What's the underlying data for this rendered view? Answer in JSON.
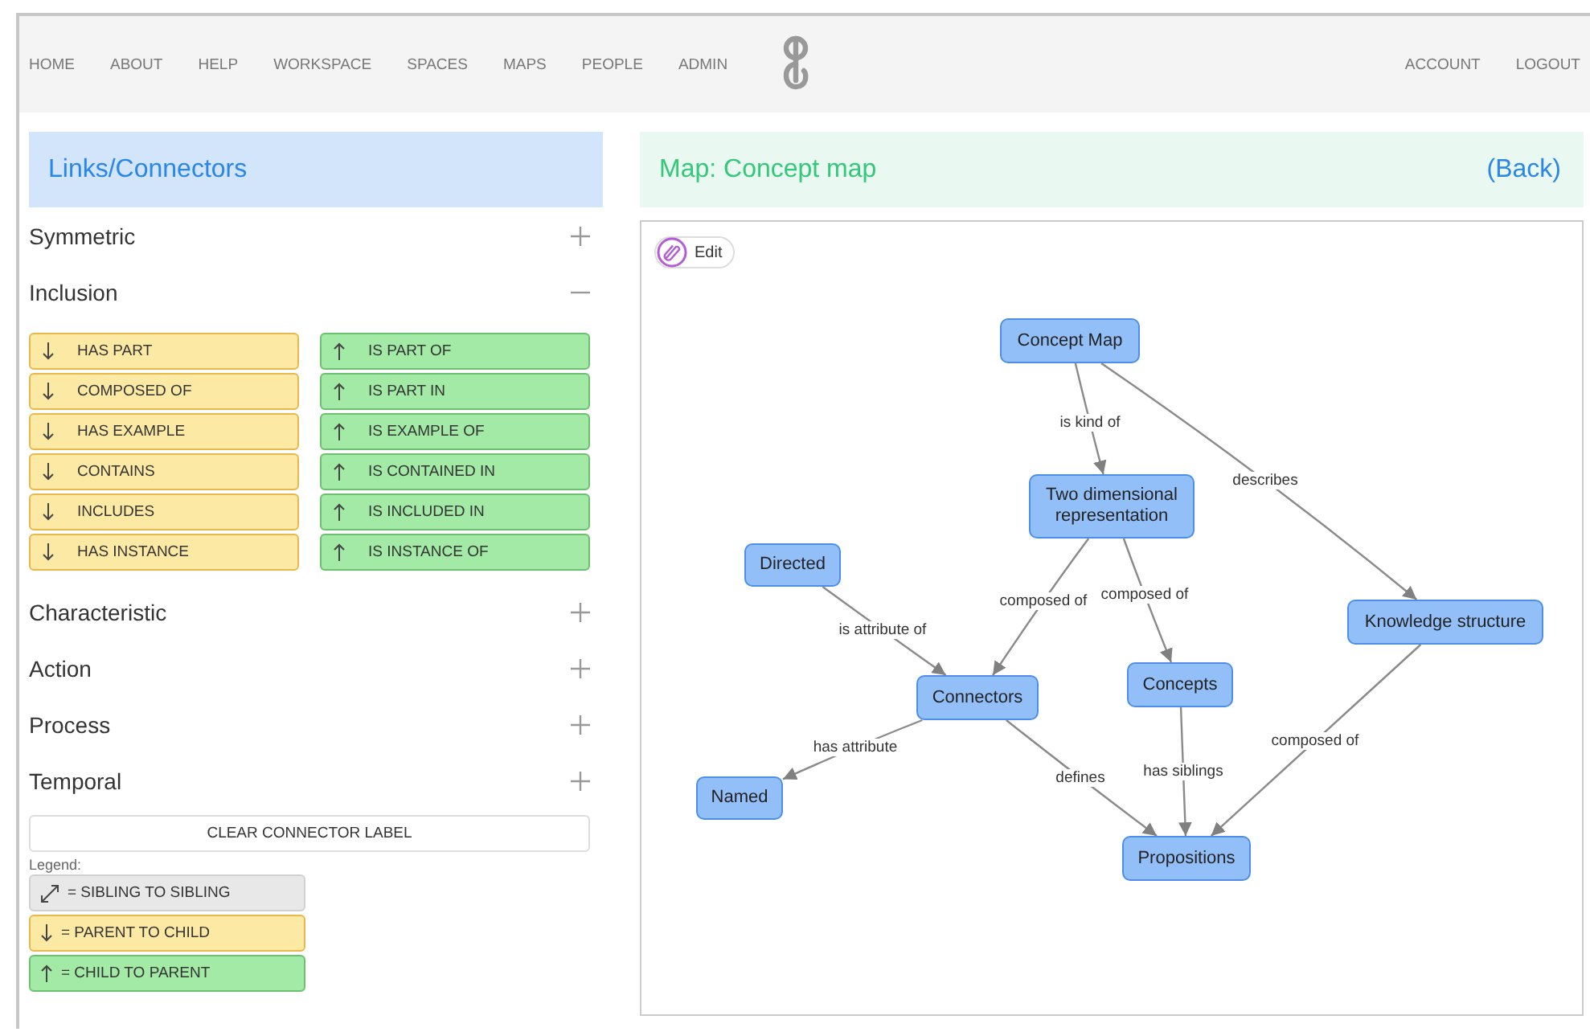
{
  "nav": {
    "left": [
      "HOME",
      "ABOUT",
      "HELP",
      "WORKSPACE",
      "SPACES",
      "MAPS",
      "PEOPLE",
      "ADMIN"
    ],
    "right": [
      "ACCOUNT",
      "LOGOUT"
    ]
  },
  "panel": {
    "title": "Links/Connectors",
    "categories": [
      {
        "name": "Symmetric",
        "expanded": false
      },
      {
        "name": "Inclusion",
        "expanded": true,
        "connectors": [
          {
            "label": "HAS PART",
            "kind": "parent"
          },
          {
            "label": "IS PART OF",
            "kind": "child"
          },
          {
            "label": "COMPOSED OF",
            "kind": "parent"
          },
          {
            "label": "IS PART IN",
            "kind": "child"
          },
          {
            "label": "HAS EXAMPLE",
            "kind": "parent"
          },
          {
            "label": "IS EXAMPLE OF",
            "kind": "child"
          },
          {
            "label": "CONTAINS",
            "kind": "parent"
          },
          {
            "label": "IS CONTAINED IN",
            "kind": "child"
          },
          {
            "label": "INCLUDES",
            "kind": "parent"
          },
          {
            "label": "IS INCLUDED IN",
            "kind": "child"
          },
          {
            "label": "HAS INSTANCE",
            "kind": "parent"
          },
          {
            "label": "IS INSTANCE OF",
            "kind": "child"
          }
        ]
      },
      {
        "name": "Characteristic",
        "expanded": false
      },
      {
        "name": "Action",
        "expanded": false
      },
      {
        "name": "Process",
        "expanded": false
      },
      {
        "name": "Temporal",
        "expanded": false
      }
    ],
    "clear_button": "CLEAR CONNECTOR LABEL",
    "legend": {
      "title": "Legend:",
      "items": [
        {
          "label": "= SIBLING TO SIBLING",
          "kind": "sibling"
        },
        {
          "label": "= PARENT TO CHILD",
          "kind": "parent"
        },
        {
          "label": "= CHILD TO PARENT",
          "kind": "child"
        }
      ]
    }
  },
  "map": {
    "title": "Map: Concept map",
    "back": "(Back)",
    "edit": "Edit",
    "nodes": [
      "Concept Map",
      "Two dimensional representation",
      "Directed",
      "Knowledge structure",
      "Connectors",
      "Concepts",
      "Named",
      "Propositions"
    ],
    "edges": [
      {
        "label": "is kind of"
      },
      {
        "label": "describes"
      },
      {
        "label": "composed of"
      },
      {
        "label": "composed of"
      },
      {
        "label": "is attribute of"
      },
      {
        "label": "has attribute"
      },
      {
        "label": "defines"
      },
      {
        "label": "has siblings"
      },
      {
        "label": "composed of"
      }
    ]
  }
}
